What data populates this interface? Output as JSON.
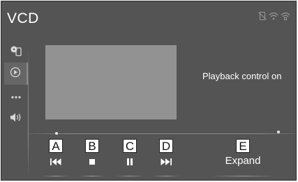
{
  "header": {
    "title": "VCD",
    "status_icons": [
      "phone-disconnected-icon",
      "wifi-icon",
      "mobile-signal-icon"
    ]
  },
  "sidebar": {
    "items": [
      {
        "icon": "source-disc-icon"
      },
      {
        "icon": "playback-icon",
        "active": true
      },
      {
        "icon": "more-options-icon"
      },
      {
        "icon": "volume-icon"
      }
    ]
  },
  "main": {
    "playback_status": "Playback control on"
  },
  "controls": [
    {
      "letter": "A",
      "icon": "skip-previous-icon"
    },
    {
      "letter": "B",
      "icon": "stop-icon"
    },
    {
      "letter": "C",
      "icon": "pause-icon"
    },
    {
      "letter": "D",
      "icon": "skip-next-icon"
    },
    {
      "letter": "E",
      "label": "Expand"
    }
  ],
  "colors": {
    "screen_bg": "#545454",
    "video_area": "#929292",
    "text": "#ffffff"
  }
}
